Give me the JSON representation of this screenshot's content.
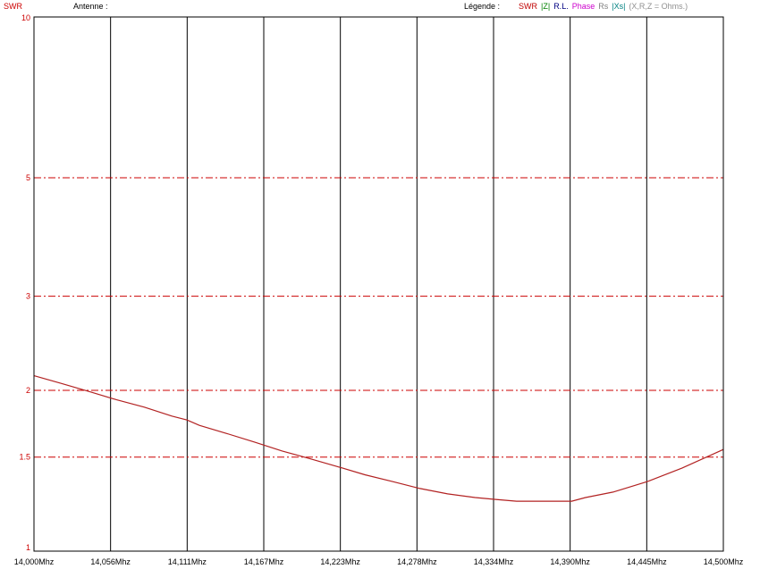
{
  "header": {
    "y_title": "SWR",
    "antenna_label": "Antenne :",
    "legend_label": "Légende :",
    "legend_items": [
      {
        "text": "SWR",
        "color": "#c00000"
      },
      {
        "text": "|Z|",
        "color": "#008000"
      },
      {
        "text": "R.L.",
        "color": "#000080"
      },
      {
        "text": "Phase",
        "color": "#cc00cc"
      },
      {
        "text": "Rs",
        "color": "#808080"
      },
      {
        "text": "|Xs|",
        "color": "#008080"
      },
      {
        "text": "(X,R,Z = Ohms.)",
        "color": "#909090"
      }
    ]
  },
  "colors": {
    "curve": "#b22222",
    "grid_dash": "#cc0000",
    "grid_solid": "#000000",
    "y_labels": "#cc0000"
  },
  "chart_data": {
    "type": "line",
    "y_scale": "log",
    "ylim": [
      1,
      10
    ],
    "y_ticks": [
      {
        "value": 10,
        "label": "10"
      },
      {
        "value": 5,
        "label": "5"
      },
      {
        "value": 3,
        "label": "3"
      },
      {
        "value": 2,
        "label": "2"
      },
      {
        "value": 1.5,
        "label": "1.5"
      },
      {
        "value": 1,
        "label": "1"
      }
    ],
    "xlim": [
      14.0,
      14.5
    ],
    "x_ticks": [
      "14,000Mhz",
      "14,056Mhz",
      "14,111Mhz",
      "14,167Mhz",
      "14,223Mhz",
      "14,278Mhz",
      "14,334Mhz",
      "14,390Mhz",
      "14,445Mhz",
      "14,500Mhz"
    ],
    "series": [
      {
        "name": "SWR",
        "x": [
          14.0,
          14.02,
          14.04,
          14.06,
          14.08,
          14.1,
          14.111,
          14.12,
          14.14,
          14.16,
          14.18,
          14.2,
          14.22,
          14.24,
          14.26,
          14.28,
          14.3,
          14.32,
          14.334,
          14.35,
          14.37,
          14.39,
          14.4,
          14.42,
          14.445,
          14.47,
          14.5
        ],
        "y": [
          2.13,
          2.06,
          1.99,
          1.92,
          1.86,
          1.79,
          1.76,
          1.72,
          1.66,
          1.6,
          1.54,
          1.49,
          1.44,
          1.39,
          1.35,
          1.31,
          1.28,
          1.26,
          1.25,
          1.24,
          1.24,
          1.24,
          1.26,
          1.29,
          1.35,
          1.43,
          1.55
        ]
      }
    ]
  }
}
